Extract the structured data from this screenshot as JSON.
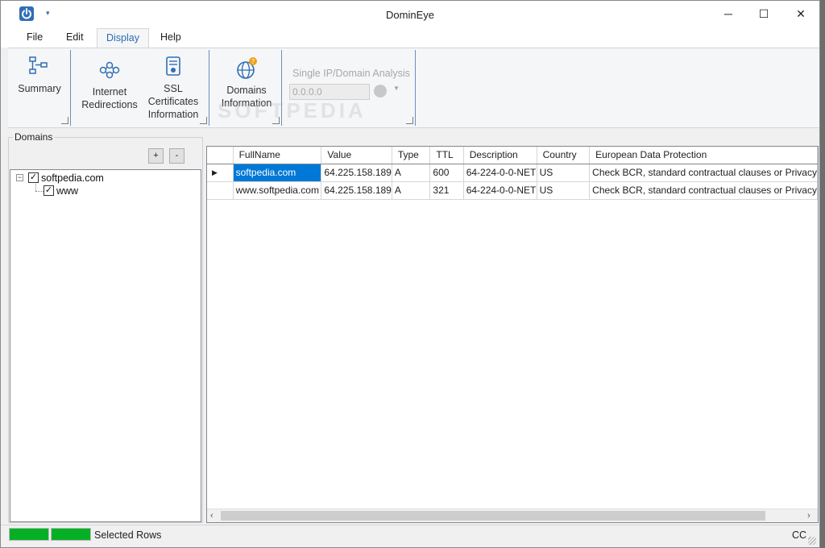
{
  "window": {
    "title": "DominEye",
    "minimize_glyph": "─",
    "maximize_glyph": "☐",
    "close_glyph": "✕",
    "qa_dropdown_glyph": "▾"
  },
  "menu_tabs": [
    {
      "label": "File"
    },
    {
      "label": "Edit"
    },
    {
      "label": "Display",
      "active": true
    },
    {
      "label": "Help"
    }
  ],
  "ribbon": {
    "summary_label": "Summary",
    "internet_redirections_label": "Internet Redirections",
    "ssl_label": "SSL Certificates Information",
    "domains_info_label": "Domains Information",
    "single_analysis_label": "Single IP/Domain Analysis",
    "ip_value": "0.0.0.0",
    "watermark": "SOFTPEDIA"
  },
  "domains_panel": {
    "title": "Domains",
    "add_label": "+",
    "remove_label": "-",
    "tree": [
      {
        "label": "softpedia.com",
        "checked": true,
        "expanded": true,
        "children": [
          {
            "label": "www",
            "checked": true
          }
        ]
      }
    ],
    "check_glyph": "✓",
    "collapse_glyph": "−"
  },
  "grid": {
    "columns": [
      "FullName",
      "Value",
      "Type",
      "TTL",
      "Description",
      "Country",
      "European Data Protection"
    ],
    "rows": [
      {
        "marker": "▶",
        "cells": [
          "softpedia.com",
          "64.225.158.189",
          "A",
          "600",
          "64-224-0-0-NET",
          "US",
          "Check BCR, standard contractual clauses or Privacy"
        ]
      },
      {
        "marker": "",
        "cells": [
          "www.softpedia.com",
          "64.225.158.189",
          "A",
          "321",
          "64-224-0-0-NET",
          "US",
          "Check BCR, standard contractual clauses or Privacy"
        ]
      }
    ],
    "scroll_left_glyph": "‹",
    "scroll_right_glyph": "›"
  },
  "statusbar": {
    "text": "Selected Rows",
    "right_text": "CC",
    "color_bar": "#06b025"
  },
  "colors": {
    "accent": "#2b6cb5",
    "selection": "#0078d7",
    "ribbon_separator": "#6b8fbf"
  }
}
